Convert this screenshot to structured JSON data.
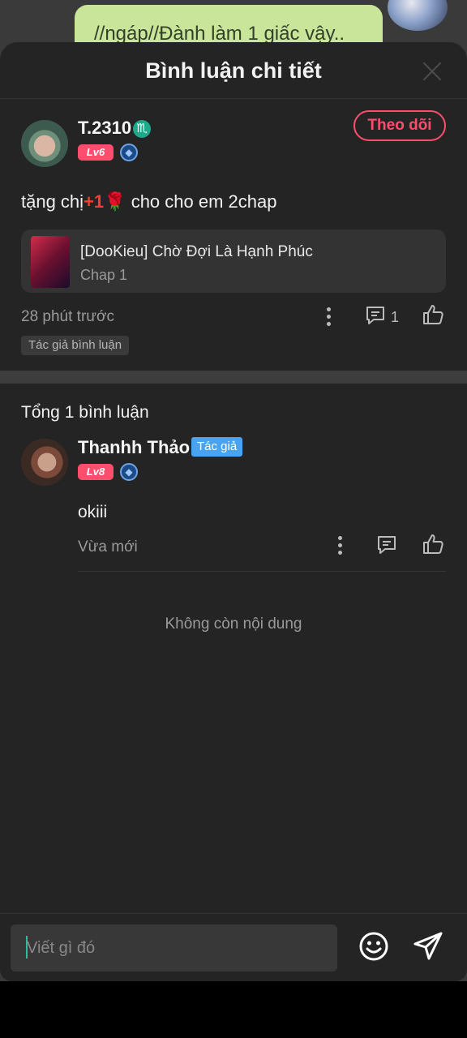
{
  "background": {
    "bubble_text": "//ngáp//Đành làm 1 giấc vậy.."
  },
  "header": {
    "title": "Bình luận chi tiết"
  },
  "main_comment": {
    "username": "T.2310",
    "zodiac_symbol": "♏",
    "level": "Lv6",
    "follow_label": "Theo dõi",
    "text_before": "tặng chị",
    "emoji_plus": "+1",
    "emoji_rose": "🌹",
    "text_after": "cho cho em 2chap",
    "chapter_title": "[DooKieu] Chờ Đợi Là Hạnh Phúc",
    "chapter_sub": "Chap 1",
    "time": "28 phút trước",
    "reply_count": "1",
    "tag": "Tác giả bình luận"
  },
  "replies": {
    "total_label": "Tổng 1 bình luận",
    "items": [
      {
        "username": "Thanhh Thảo",
        "author_badge": "Tác giả",
        "level": "Lv8",
        "text": "okiii",
        "time": "Vừa mới"
      }
    ],
    "end_label": "Không còn nội dung"
  },
  "composer": {
    "placeholder": "Viết gì đó"
  },
  "colors": {
    "accent": "#ff4d6d",
    "author_badge": "#4aa3f0",
    "sheet_bg": "#242424"
  },
  "icons": [
    "close-icon",
    "zodiac-icon",
    "gem-icon",
    "more-icon",
    "comment-icon",
    "like-icon",
    "emoji-icon",
    "send-icon"
  ]
}
